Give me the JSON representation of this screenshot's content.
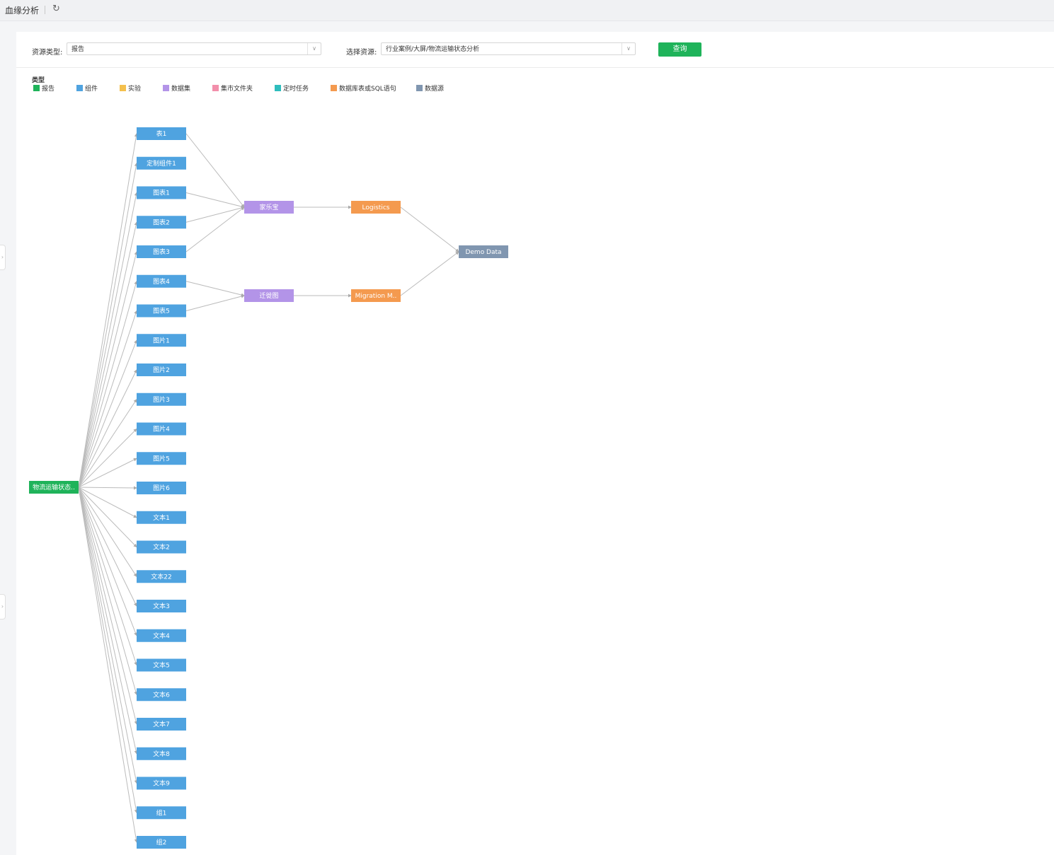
{
  "header": {
    "title": "血缘分析",
    "refresh_icon": "refresh-icon"
  },
  "filters": {
    "type_label": "资源类型:",
    "type_value": "报告",
    "resource_label": "选择资源:",
    "resource_value": "行业案例/大屏/物流运输状态分析",
    "query_label": "查询"
  },
  "legend": {
    "title": "类型",
    "items": [
      {
        "label": "报告",
        "color": "#1fb35a"
      },
      {
        "label": "组件",
        "color": "#4fa3e0"
      },
      {
        "label": "实验",
        "color": "#f4c04e"
      },
      {
        "label": "数据集",
        "color": "#b394e8"
      },
      {
        "label": "集市文件夹",
        "color": "#f28fab"
      },
      {
        "label": "定时任务",
        "color": "#2fbdbd"
      },
      {
        "label": "数据库表或SQL语句",
        "color": "#f49a4f"
      },
      {
        "label": "数据源",
        "color": "#8096b0"
      }
    ]
  },
  "graph": {
    "root": {
      "label": "物流运输状态..",
      "type": "报告"
    },
    "components": [
      "表1",
      "定制组件1",
      "图表1",
      "图表2",
      "图表3",
      "图表4",
      "图表5",
      "图片1",
      "图片2",
      "图片3",
      "图片4",
      "图片5",
      "图片6",
      "文本1",
      "文本2",
      "文本22",
      "文本3",
      "文本4",
      "文本5",
      "文本6",
      "文本7",
      "文本8",
      "文本9",
      "组1",
      "组2"
    ],
    "datasets": [
      {
        "label": "家乐宝",
        "sources": [
          "表1",
          "图表1",
          "图表2",
          "图表3"
        ]
      },
      {
        "label": "迁徙图",
        "sources": [
          "图表4",
          "图表5"
        ]
      }
    ],
    "tables": [
      {
        "label": "Logistics",
        "dataset": "家乐宝"
      },
      {
        "label": "Migration M..",
        "dataset": "迁徙图"
      }
    ],
    "datasource": {
      "label": "Demo Data"
    }
  }
}
